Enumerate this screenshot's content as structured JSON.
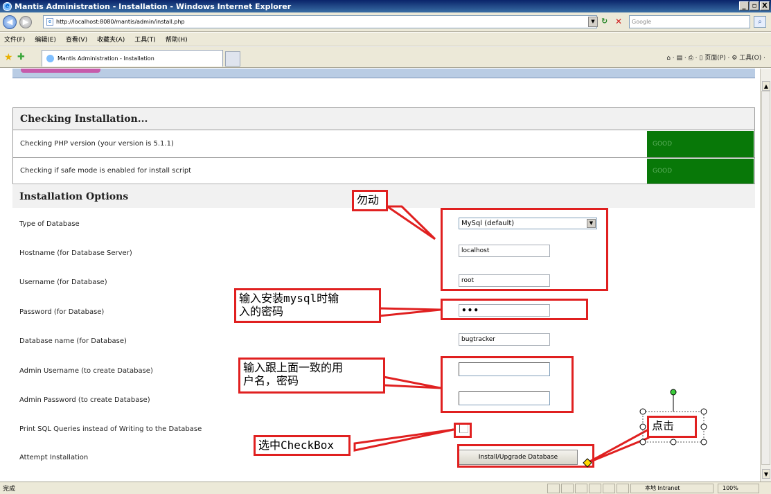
{
  "window": {
    "title": "Mantis Administration - Installation - Windows Internet Explorer",
    "min": "_",
    "max": "▫",
    "close": "X"
  },
  "address": {
    "url": "http://localhost:8080/mantis/admin/install.php",
    "search_placeholder": "Google"
  },
  "menu": [
    "文件(F)",
    "编辑(E)",
    "查看(V)",
    "收藏夹(A)",
    "工具(T)",
    "帮助(H)"
  ],
  "tab": {
    "label": "Mantis Administration - Installation"
  },
  "commandbar": "⌂ · ▤ · ⎙ · ▯ 页面(P) · ⚙ 工具(O) ·",
  "checking": {
    "heading": "Checking Installation...",
    "rows": [
      {
        "label": "Checking PHP version (your version is 5.1.1)",
        "status": "GOOD"
      },
      {
        "label": "Checking if safe mode is enabled for install script",
        "status": "GOOD"
      }
    ]
  },
  "options": {
    "heading": "Installation Options",
    "rows": [
      {
        "label": "Type of Database"
      },
      {
        "label": "Hostname (for Database Server)"
      },
      {
        "label": "Username (for Database)"
      },
      {
        "label": "Password (for Database)"
      },
      {
        "label": "Database name (for Database)"
      },
      {
        "label": "Admin Username (to create Database)"
      },
      {
        "label": "Admin Password (to create Database)"
      },
      {
        "label": "Print SQL Queries instead of Writing to the Database"
      },
      {
        "label": "Attempt Installation"
      }
    ],
    "db_type": "MySql (default)",
    "hostname": "localhost",
    "username": "root",
    "password": "•••",
    "dbname": "bugtracker",
    "install_button": "Install/Upgrade Database"
  },
  "annotations": {
    "do_not_change": "勿动",
    "enter_password": "输入安装mysql时输\n入的密码",
    "same_as_above": "输入跟上面一致的用\n户名，密码",
    "check_checkbox": "选中CheckBox",
    "click": "点击"
  },
  "status": {
    "left": "完成",
    "zone": "本地 Intranet",
    "zoom": "100%"
  },
  "colors": {
    "annotation": "#e02020",
    "good_bg": "#087808",
    "title_bar": "#0a246a"
  }
}
